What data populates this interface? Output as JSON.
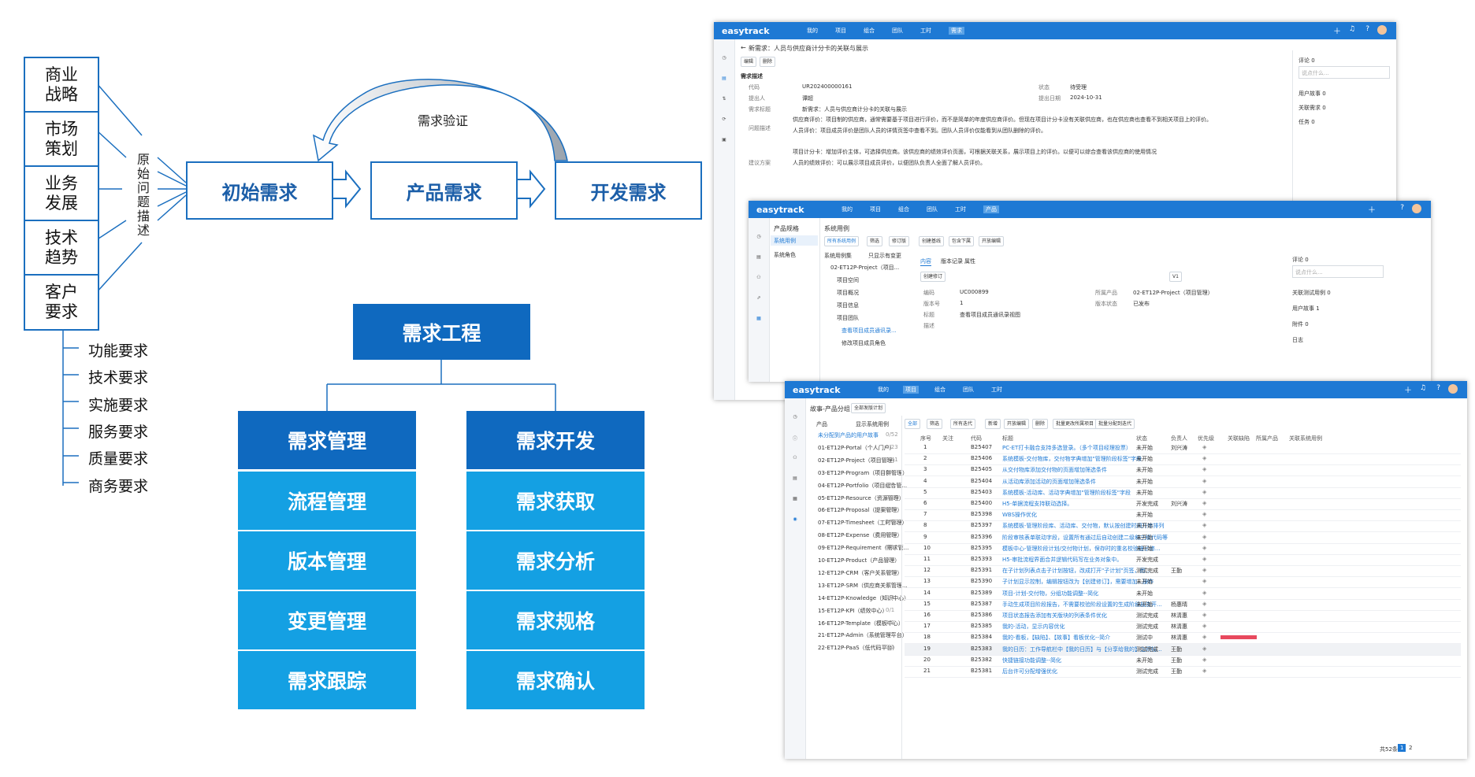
{
  "diagram": {
    "sources": [
      "商业\n战略",
      "市场\n策划",
      "业务\n发展",
      "技术\n趋势",
      "客户\n要求"
    ],
    "bracket_label": "原\n始\n问\n题\n描\n述",
    "flow": [
      "初始需求",
      "产品需求",
      "开发需求"
    ],
    "verify_label": "需求验证",
    "requirement_types": [
      "功能要求",
      "技术要求",
      "实施要求",
      "服务要求",
      "质量要求",
      "商务要求"
    ],
    "engineering": {
      "root": "需求工程",
      "left": [
        "需求管理",
        "流程管理",
        "版本管理",
        "变更管理",
        "需求跟踪"
      ],
      "right": [
        "需求开发",
        "需求获取",
        "需求分析",
        "需求规格",
        "需求确认"
      ]
    },
    "colors": {
      "dark": "#0f69bf",
      "light": "#14a0e3",
      "stroke": "#1b6fbf"
    }
  },
  "win1": {
    "logo": "easytrack",
    "nav": [
      "我的",
      "项目",
      "组合",
      "团队",
      "工时",
      "需求"
    ],
    "title": "新需求：人员与供应商计分卡的关联与展示",
    "buttons": [
      "编辑",
      "删除"
    ],
    "section": "需求描述",
    "fields": [
      {
        "label": "代码",
        "value": "UR202400000161",
        "label2": "状态",
        "value2": "待受理"
      },
      {
        "label": "提出人",
        "value": "谭超",
        "label2": "提出日期",
        "value2": "2024-10-31"
      },
      {
        "label": "需求标题",
        "value": "新需求：人员与供应商计分卡的关联与展示",
        "label2": "",
        "value2": ""
      }
    ],
    "problem_label": "问题描述",
    "problem_lines": [
      "供应商评价：项目制的供应商，通常需要基于项目进行评价，而不是简单的年度供应商评价。但现在项目计分卡没有关联供应商，也在供应商也查看不到相关项目上的评价。",
      "人员评价：项目成员评价是团队人员的详情页签中查看不到。团队人员评价仅能看到从团队删除的评价。"
    ],
    "suggest_label": "建议方案",
    "suggest_lines": [
      "项目计分卡：增加评价主体，可选择供应商。该供应商的绩效评价页面，可根据关联关系，展示项目上的评价。以便可以综合查看该供应商的使用情况",
      "人员的绩效评价：可以展示项目成员评价，以便团队负责人全面了解人员评价。"
    ],
    "right_panel": {
      "comment": "评论 0",
      "comment_placeholder": "说点什么...",
      "items": [
        "用户故事 0",
        "关联需求 0",
        "任务 0"
      ]
    }
  },
  "win2": {
    "logo": "easytrack",
    "nav": [
      "我的",
      "项目",
      "组合",
      "团队",
      "工时",
      "产品"
    ],
    "module": "产品规格",
    "menu": [
      "系统用例",
      "系统角色"
    ],
    "title": "系统用例",
    "toolbar": [
      "所有系统用例",
      "筛选",
      "修订版",
      "创建基线",
      "包含下属",
      "开放编辑"
    ],
    "tree_header": "系统用例集",
    "tree_toggle": "只显示有变更",
    "tree": [
      "02-ET12P-Project（项目...",
      "项目空间",
      "项目概况",
      "项目信息",
      "项目团队",
      "查看项目成员通讯录...",
      "修改项目成员角色"
    ],
    "tabs": [
      "内容",
      "版本记录",
      "属性"
    ],
    "create_btn": "创建修订",
    "version": "V1",
    "fields": [
      {
        "label": "编码",
        "value": "UC000899",
        "label2": "所属产品",
        "value2": "02-ET12P-Project（项目管理）"
      },
      {
        "label": "版本号",
        "value": "1",
        "label2": "版本状态",
        "value2": "已发布"
      },
      {
        "label": "标题",
        "value": "查看项目成员通讯录视图",
        "label2": "",
        "value2": ""
      },
      {
        "label": "描述",
        "value": "",
        "label2": "",
        "value2": ""
      }
    ],
    "right_panel": {
      "comment": "评论 0",
      "comment_placeholder": "说点什么...",
      "items": [
        "关联测试用例 0",
        "用户故事 1",
        "附件 0",
        "日志"
      ]
    }
  },
  "win3": {
    "logo": "easytrack",
    "nav": [
      "我的",
      "项目",
      "组合",
      "团队",
      "工时"
    ],
    "title": "故事-产品分组",
    "scope": "全部发版计划",
    "left_header": "产品",
    "left_toggle": "显示系统用例",
    "groups": [
      "未分配到产品的用户故事",
      "01-ET12P-Portal（个人门户）",
      "02-ET12P-Project（项目管理）",
      "03-ET12P-Program（项目群管理）",
      "04-ET12P-Portfolio（项目组合管...",
      "05-ET12P-Resource（资源管理）",
      "06-ET12P-Proposal（提案管理）",
      "07-ET12P-Timesheet（工时管理）",
      "08-ET12P-Expense（费用管理）",
      "09-ET12P-Requirement（需求管...",
      "10-ET12P-Product（产品管理）",
      "12-ET12P-CRM（客户关系管理）",
      "13-ET12P-SRM（供应商关系管理...",
      "14-ET12P-Knowledge（知识中心）",
      "15-ET12P-KPI（绩效中心）",
      "16-ET12P-Template（模板中心）",
      "21-ET12P-Admin（系统管理平台）",
      "22-ET12P-PaaS（低代码平台）"
    ],
    "group_counts": [
      "0/52",
      "0/23",
      "0/41",
      "0/4",
      "0/6",
      "0/15",
      "0/8",
      "0/30",
      "0/8",
      "0/1",
      "0/4",
      "0/9",
      "0/7",
      "0/1",
      "0/1",
      "0/2",
      "0/5",
      "0/1"
    ],
    "toolbar": [
      "全部",
      "筛选",
      "所有迭代",
      "新增",
      "开放编辑",
      "删除",
      "批量更改所属项目",
      "批量分配到迭代"
    ],
    "columns": [
      "序号",
      "关注",
      "代码",
      "标题",
      "状态",
      "负责人",
      "优先级",
      "关联缺陷",
      "所属产品",
      "关联系统用例"
    ],
    "rows": [
      {
        "n": "1",
        "code": "B25407",
        "title": "PC-ET打卡融合支持多选登录。（多个项目经理投票）",
        "status": "未开始",
        "owner": "刘兴涛"
      },
      {
        "n": "2",
        "code": "B25406",
        "title": "系统模板-交付物库，交付物字典增加\"管理阶段标签\"字段",
        "status": "未开始",
        "owner": ""
      },
      {
        "n": "3",
        "code": "B25405",
        "title": "从交付物库添加交付物的页面增加筛选条件",
        "status": "未开始",
        "owner": ""
      },
      {
        "n": "4",
        "code": "B25404",
        "title": "从活动库添加活动的页面增加筛选条件",
        "status": "未开始",
        "owner": ""
      },
      {
        "n": "5",
        "code": "B25403",
        "title": "系统模板-活动库、活动字典增加\"管理阶段标签\"字段",
        "status": "未开始",
        "owner": ""
      },
      {
        "n": "6",
        "code": "B25400",
        "title": "H5-单据流程支持联动选择。",
        "status": "开发完成",
        "owner": "刘兴涛"
      },
      {
        "n": "7",
        "code": "B25398",
        "title": "WBS操作优化",
        "status": "未开始",
        "owner": ""
      },
      {
        "n": "8",
        "code": "B25397",
        "title": "系统模板-管理阶段库、活动库、交付物，默认按创建时间升序排列",
        "status": "未开始",
        "owner": ""
      },
      {
        "n": "9",
        "code": "B25396",
        "title": "阶段审核表单联动字段，设置所有通过后自动创建二级和三级代码等",
        "status": "未开始",
        "owner": ""
      },
      {
        "n": "10",
        "code": "B25395",
        "title": "模板中心-管理阶段计划/交付物计划，保存时的重名校验提示修...",
        "status": "未开始",
        "owner": ""
      },
      {
        "n": "11",
        "code": "B25393",
        "title": "H5-审批流程界面合并逻辑代码写在业务对象中。",
        "status": "开发完成",
        "owner": ""
      },
      {
        "n": "12",
        "code": "B25391",
        "title": "在子计划列表点击子计划按钮，改成打开\"子计划\"页签，而...",
        "status": "测试完成",
        "owner": "王勤"
      },
      {
        "n": "13",
        "code": "B25390",
        "title": "子计划显示控制，编辑按钮改为【创建修订】，需要增加...操作",
        "status": "未开始",
        "owner": ""
      },
      {
        "n": "14",
        "code": "B25389",
        "title": "项目-计划-交付物，分组功能调整--简化",
        "status": "未开始",
        "owner": ""
      },
      {
        "n": "15",
        "code": "B25387",
        "title": "手动生成项目阶段报告，不需要校验阶段设置的生成阶段报告开...",
        "status": "未开始",
        "owner": "杨惠晴"
      },
      {
        "n": "16",
        "code": "B25386",
        "title": "项目状态报告添加有关版块的列表条件优化",
        "status": "测试完成",
        "owner": "林清惠"
      },
      {
        "n": "17",
        "code": "B25385",
        "title": "我的-活动，显示内容优化",
        "status": "测试完成",
        "owner": "林清惠"
      },
      {
        "n": "18",
        "code": "B25384",
        "title": "我的-看板，【缺陷】、【故事】看板优化--简介",
        "status": "测试中",
        "owner": "林清惠"
      },
      {
        "n": "19",
        "code": "B25383",
        "title": "我的日历：工作导航栏中【我的日历】与【分享给我的】之间拉...",
        "status": "测试完成",
        "owner": "王勤"
      },
      {
        "n": "20",
        "code": "B25382",
        "title": "快捷链接功能调整--简化",
        "status": "未开始",
        "owner": "王勤"
      },
      {
        "n": "21",
        "code": "B25381",
        "title": "后台许可分配增强优化",
        "status": "测试完成",
        "owner": "王勤"
      }
    ],
    "footer": {
      "total": "共52条",
      "pages": [
        "1",
        "2"
      ]
    }
  }
}
